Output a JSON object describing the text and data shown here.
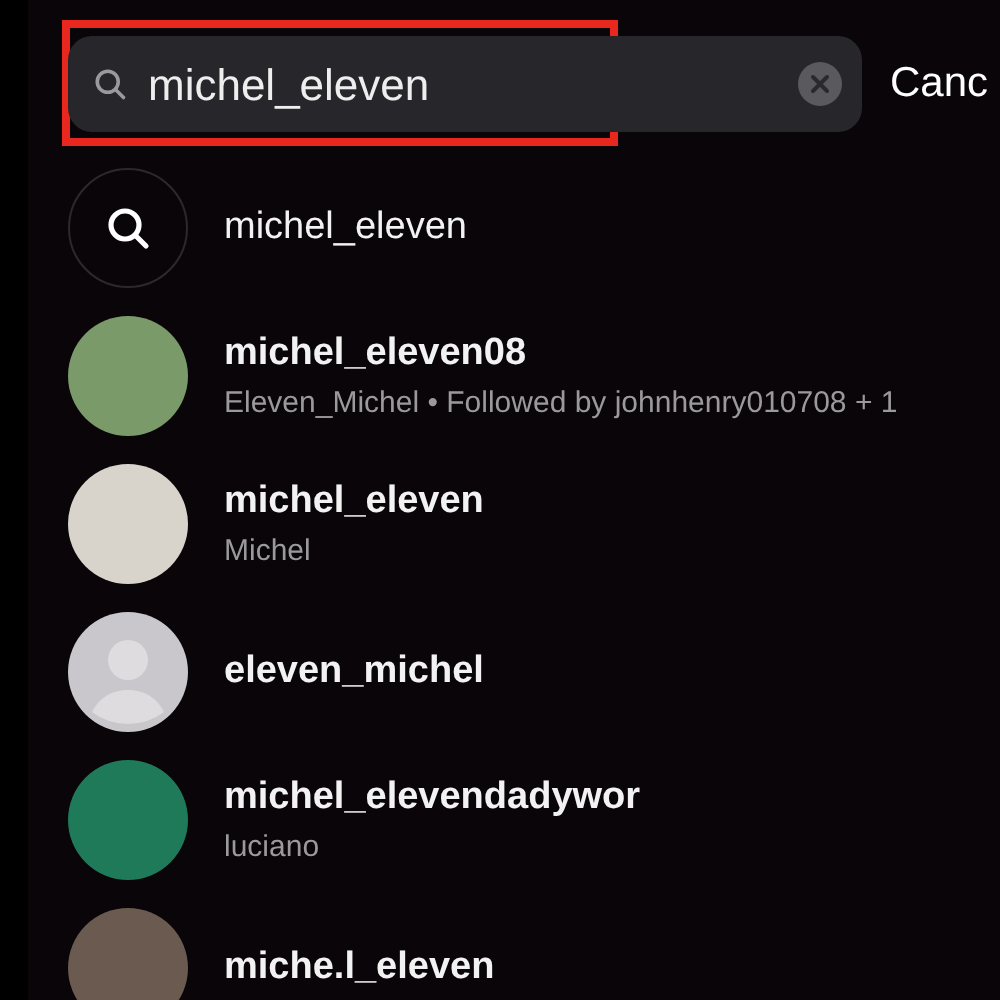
{
  "search": {
    "value": "michel_eleven",
    "highlighted": true
  },
  "cancel": "Canc",
  "results": [
    {
      "kind": "query",
      "name": "michel_eleven"
    },
    {
      "kind": "photo",
      "color": "#7a9a6a",
      "name": "michel_eleven08",
      "subtitle": "Eleven_Michel • Followed by johnhenry010708 + 1"
    },
    {
      "kind": "photo",
      "color": "#d8d4cc",
      "name": "michel_eleven",
      "subtitle": "Michel"
    },
    {
      "kind": "default",
      "name": "eleven_michel"
    },
    {
      "kind": "photo",
      "color": "#1f7a5a",
      "name": "michel_elevendadywor",
      "subtitle": "luciano"
    },
    {
      "kind": "photo",
      "color": "#6a5a50",
      "name": "miche.l_eleven"
    }
  ]
}
